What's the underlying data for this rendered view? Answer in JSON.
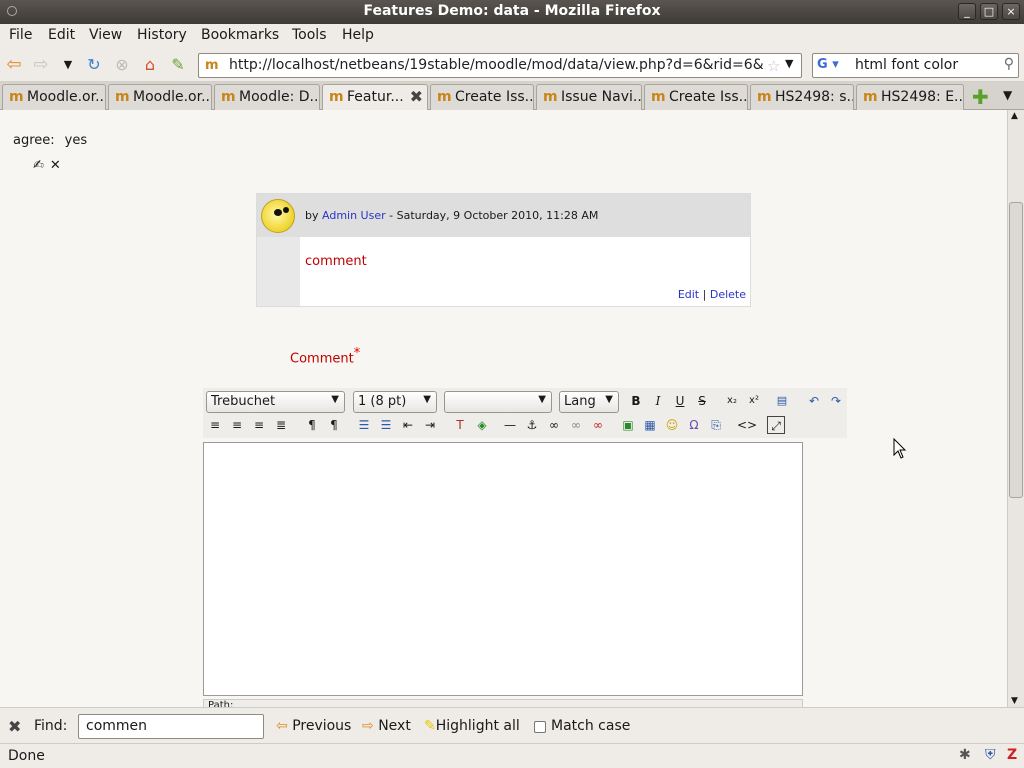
{
  "window": {
    "title": "Features Demo: data - Mozilla Firefox",
    "minimize": "_",
    "maximize": "□",
    "close": "×"
  },
  "menu": [
    "File",
    "Edit",
    "View",
    "History",
    "Bookmarks",
    "Tools",
    "Help"
  ],
  "url": "http://localhost/netbeans/19stable/moodle/mod/data/view.php?d=6&rid=6&mo",
  "search_value": "html font color",
  "tabs": [
    {
      "label": "Moodle.or...",
      "active": false
    },
    {
      "label": "Moodle.or...",
      "active": false
    },
    {
      "label": "Moodle: D...",
      "active": false
    },
    {
      "label": "Featur...",
      "active": true
    },
    {
      "label": "Create Iss...",
      "active": false
    },
    {
      "label": "Issue Navi...",
      "active": false
    },
    {
      "label": "Create Iss...",
      "active": false
    },
    {
      "label": "HS2498: s...",
      "active": false
    },
    {
      "label": "HS2498: E...",
      "active": false
    }
  ],
  "record": {
    "field_label": "agree:",
    "field_value": "yes"
  },
  "comment": {
    "by_prefix": "by",
    "author": "Admin User",
    "date": "- Saturday, 9 October 2010, 11:28 AM",
    "text": "comment",
    "edit_label": "Edit",
    "separator": "|",
    "delete_label": "Delete"
  },
  "comment_form": {
    "label": "Comment",
    "required_mark": "*"
  },
  "editor": {
    "font": "Trebuchet",
    "size": "1 (8 pt)",
    "format": "",
    "lang": "Lang",
    "path_label": "Path:"
  },
  "findbar": {
    "label": "Find:",
    "query": "commen",
    "previous": "Previous",
    "next": "Next",
    "highlight": "Highlight all",
    "match_case": "Match case"
  },
  "status": "Done"
}
